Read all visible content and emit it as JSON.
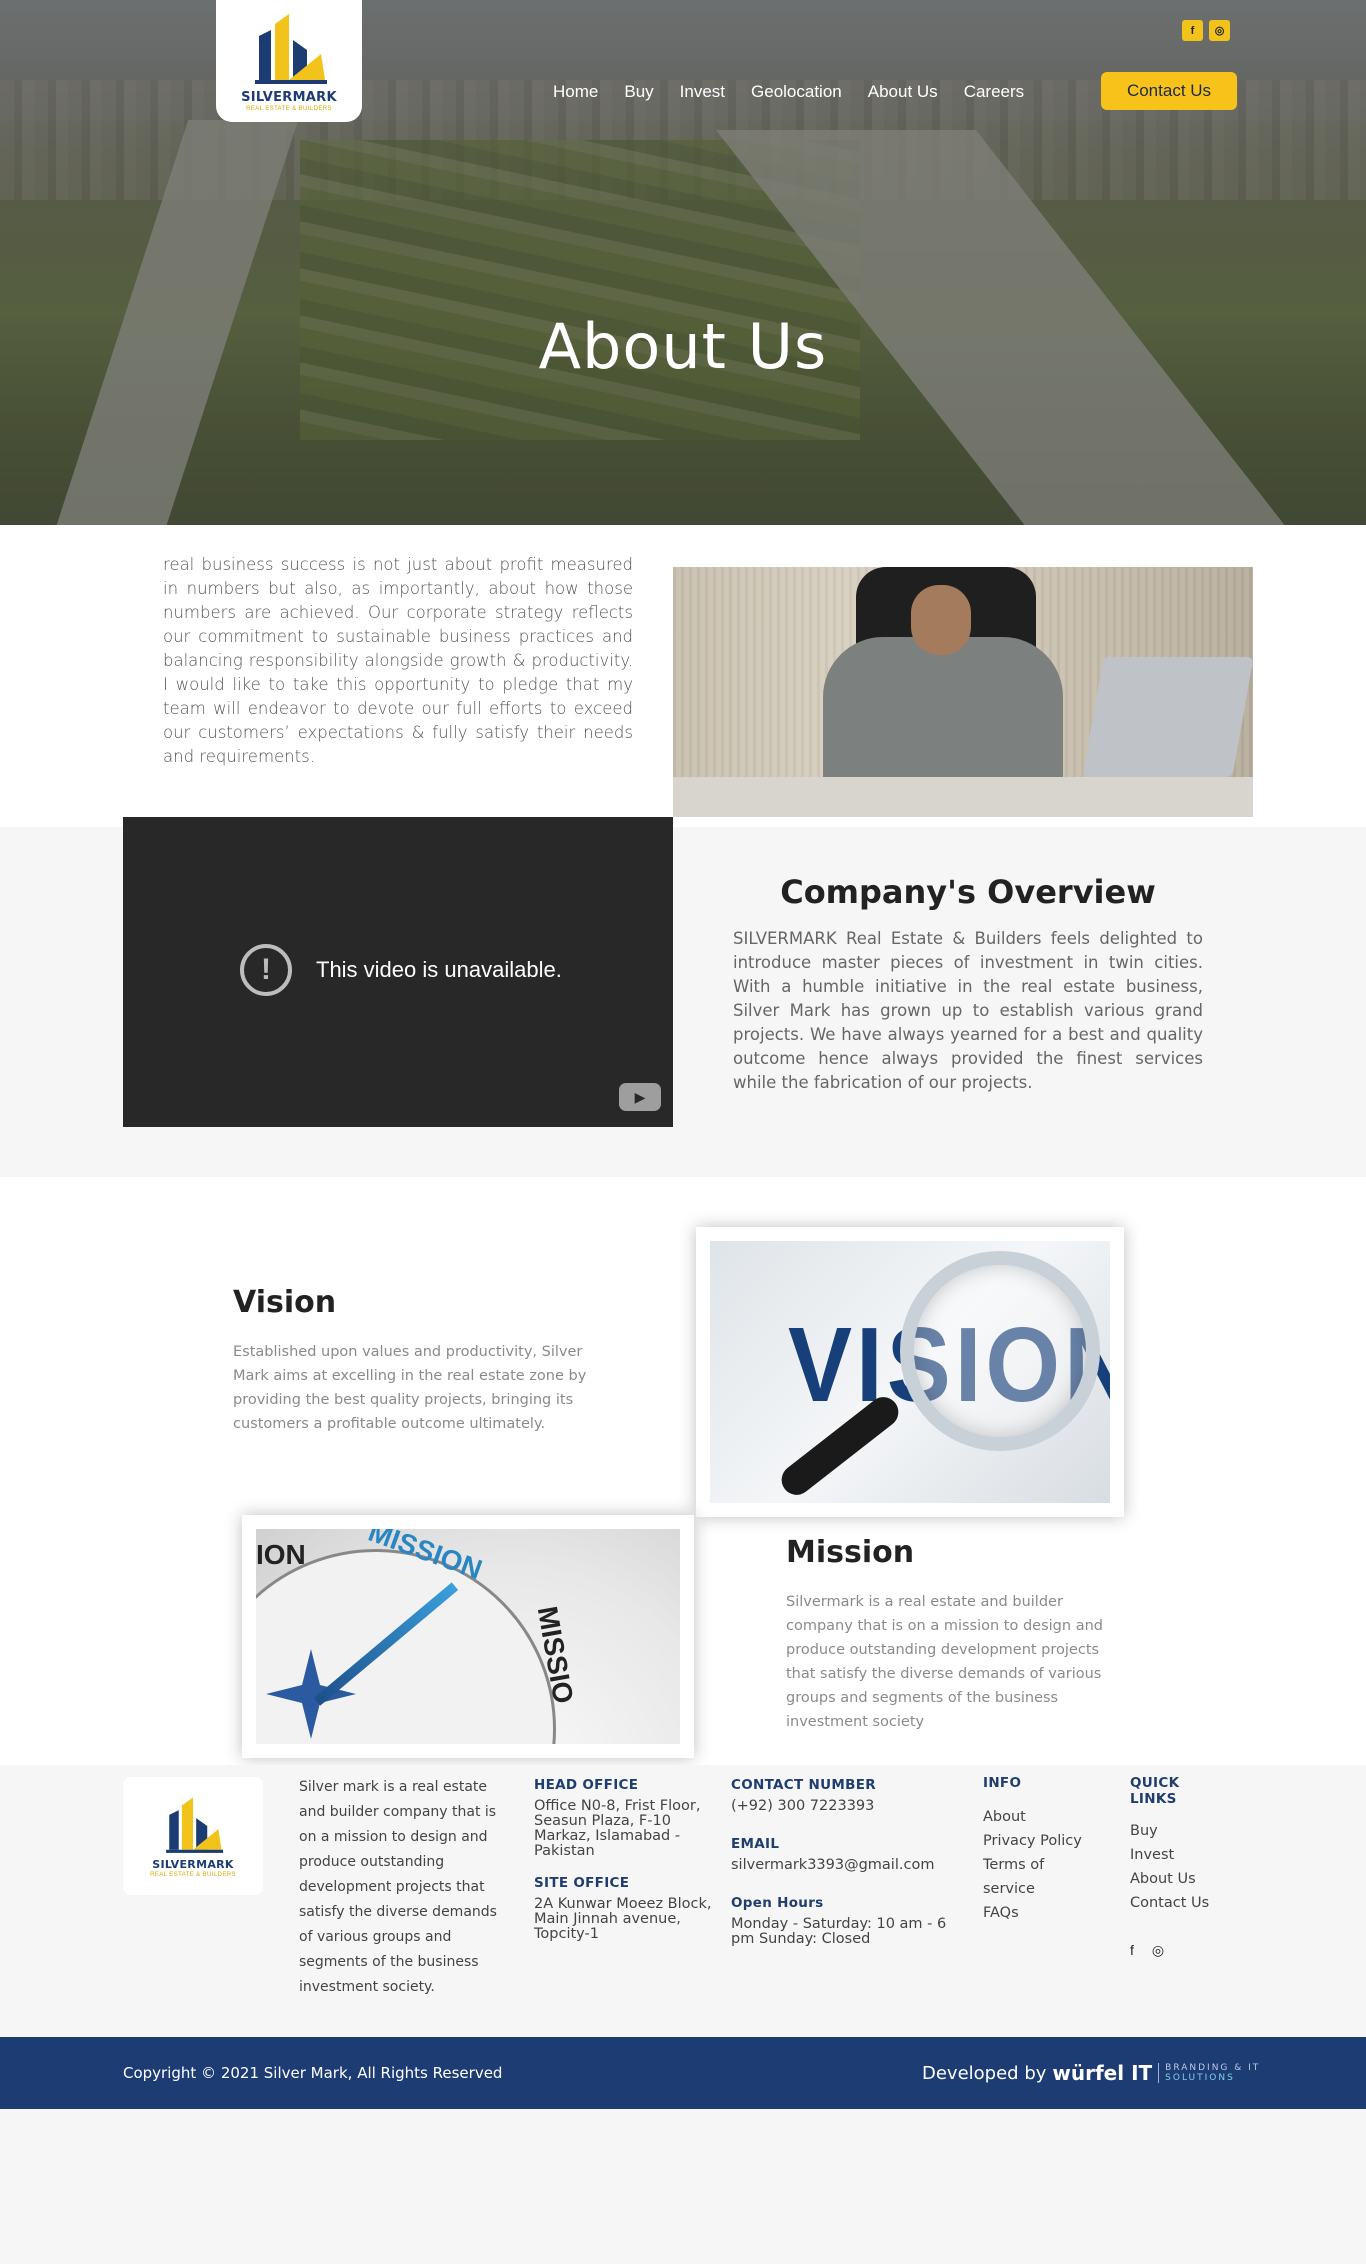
{
  "brand": {
    "name": "SILVERMARK",
    "tagline": "REAL ESTATE & BUILDERS"
  },
  "header": {
    "nav": [
      "Home",
      "Buy",
      "Invest",
      "Geolocation",
      "About Us",
      "Careers"
    ],
    "contact_label": "Contact Us",
    "social": [
      "facebook-icon",
      "instagram-icon"
    ]
  },
  "hero": {
    "title": "About Us"
  },
  "ceo": {
    "text": "real business success is not just about profit measured in numbers but also, as importantly, about how those numbers are achieved. Our corporate strategy reflects our commitment to sustainable business practices and balancing responsibility alongside growth & productivity. I would like to take this opportunity to pledge that my team will endeavor to devote our full efforts to exceed our customers’ expectations & fully satisfy their needs and requirements."
  },
  "overview": {
    "video_message": "This video is unavailable.",
    "title": "Company's Overview",
    "text": "SILVERMARK Real Estate & Builders feels delighted to introduce master pieces of investment in twin cities. With a humble initiative in the real estate business, Silver Mark has grown up to establish various grand projects. We have always yearned for a best and quality outcome hence always provided the finest services while the fabrication of our projects."
  },
  "vision": {
    "title": "Vision",
    "text": "Established upon values and productivity, Silver Mark aims at excelling in the real estate zone by providing the best quality projects, bringing its customers a profitable outcome ultimately.",
    "image_word": "VISION"
  },
  "mission": {
    "title": "Mission",
    "text": "Silvermark is a real estate and builder company that is on a mission to design and produce outstanding development projects that satisfy the diverse demands of various groups and segments of the business investment society",
    "image_words": [
      "ION",
      "MISSION",
      "MISSIO"
    ]
  },
  "footer": {
    "about": "Silver mark is a real estate and builder company that is on a mission to design and produce outstanding development projects that satisfy the diverse demands of various groups and segments of the business investment society.",
    "head_office_label": "HEAD OFFICE",
    "head_office": "Office N0-8, Frist Floor, Seasun Plaza, F-10 Markaz, Islamabad - Pakistan",
    "site_office_label": "SITE OFFICE",
    "site_office": "2A Kunwar Moeez Block, Main Jinnah avenue, Topcity-1",
    "contact_label": "CONTACT NUMBER",
    "contact": "(+92) 300 7223393",
    "email_label": "EMAIL",
    "email": "silvermark3393@gmail.com",
    "hours_label": "Open Hours",
    "hours": "Monday - Saturday: 10 am - 6 pm Sunday: Closed",
    "info_label": "INFO",
    "info_links": [
      "About",
      "Privacy Policy",
      "Terms of service",
      "FAQs"
    ],
    "quick_label": "QUICK LINKS",
    "quick_links": [
      "Buy",
      "Invest",
      "About Us",
      "Contact Us"
    ]
  },
  "bottom": {
    "copyright": "Copyright © 2021 Silver Mark, All Rights Reserved",
    "developed_by": "Developed by",
    "dev_brand": "würfel IT",
    "dev_tag1": "BRANDING & IT",
    "dev_tag2": "SOLUTIONS"
  },
  "colors": {
    "accent": "#f7c31b",
    "navy": "#1d3c73"
  }
}
